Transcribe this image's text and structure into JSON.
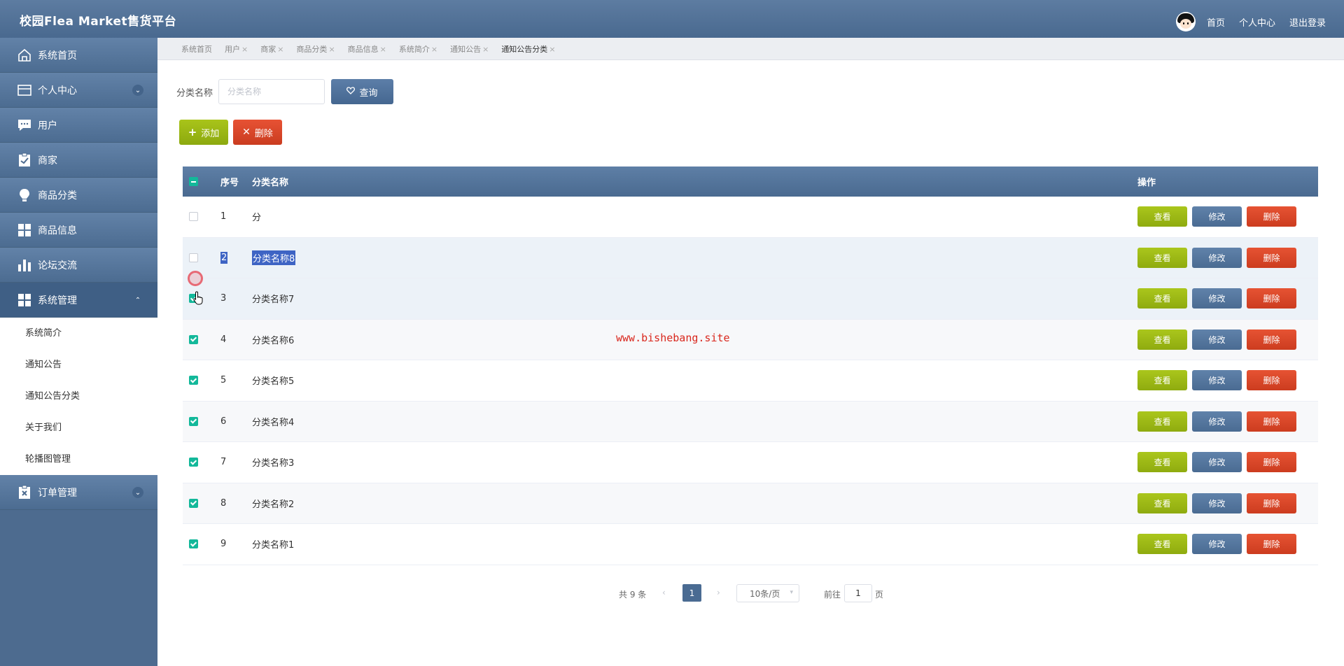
{
  "header": {
    "title": "校园Flea Market售货平台",
    "nav": [
      "首页",
      "个人中心",
      "退出登录"
    ]
  },
  "sidebar": {
    "items": [
      {
        "label": "系统首页",
        "icon": "home-icon"
      },
      {
        "label": "个人中心",
        "icon": "card-icon",
        "expandable": true
      },
      {
        "label": "用户",
        "icon": "chat-icon"
      },
      {
        "label": "商家",
        "icon": "clipboard-check-icon"
      },
      {
        "label": "商品分类",
        "icon": "bulb-icon"
      },
      {
        "label": "商品信息",
        "icon": "grid-icon"
      },
      {
        "label": "论坛交流",
        "icon": "bar-chart-icon"
      },
      {
        "label": "系统管理",
        "icon": "grid-icon",
        "expanded": true
      }
    ],
    "submenu": [
      "系统简介",
      "通知公告",
      "通知公告分类",
      "关于我们",
      "轮播图管理"
    ],
    "last_item": {
      "label": "订单管理",
      "icon": "clipboard-x-icon"
    }
  },
  "tabs": [
    "系统首页",
    "用户",
    "商家",
    "商品分类",
    "商品信息",
    "系统简介",
    "通知公告",
    "通知公告分类"
  ],
  "tab_close": "×",
  "search": {
    "label": "分类名称",
    "placeholder": "分类名称",
    "query_button": "查询"
  },
  "actions": {
    "add": "添加",
    "delete": "删除"
  },
  "table": {
    "headers": {
      "no": "序号",
      "name": "分类名称",
      "op": "操作"
    },
    "rows": [
      {
        "no": "1",
        "name": "分",
        "checked": false
      },
      {
        "no": "2",
        "name": "分类名称8",
        "checked": false
      },
      {
        "no": "3",
        "name": "分类名称7",
        "checked": true
      },
      {
        "no": "4",
        "name": "分类名称6",
        "checked": true
      },
      {
        "no": "5",
        "name": "分类名称5",
        "checked": true
      },
      {
        "no": "6",
        "name": "分类名称4",
        "checked": true
      },
      {
        "no": "7",
        "name": "分类名称3",
        "checked": true
      },
      {
        "no": "8",
        "name": "分类名称2",
        "checked": true
      },
      {
        "no": "9",
        "name": "分类名称1",
        "checked": true
      }
    ],
    "op_labels": {
      "view": "查看",
      "edit": "修改",
      "del": "删除"
    }
  },
  "watermark": "www.bishebang.site",
  "pager": {
    "total": "共 9 条",
    "current": "1",
    "page_size": "10条/页",
    "goto_label": "前往",
    "goto_value": "1",
    "unit": "页"
  },
  "colors": {
    "primary": "#4a6b92",
    "view": "#9bb716",
    "delete": "#d9452a",
    "checkbox": "#13b89a"
  }
}
